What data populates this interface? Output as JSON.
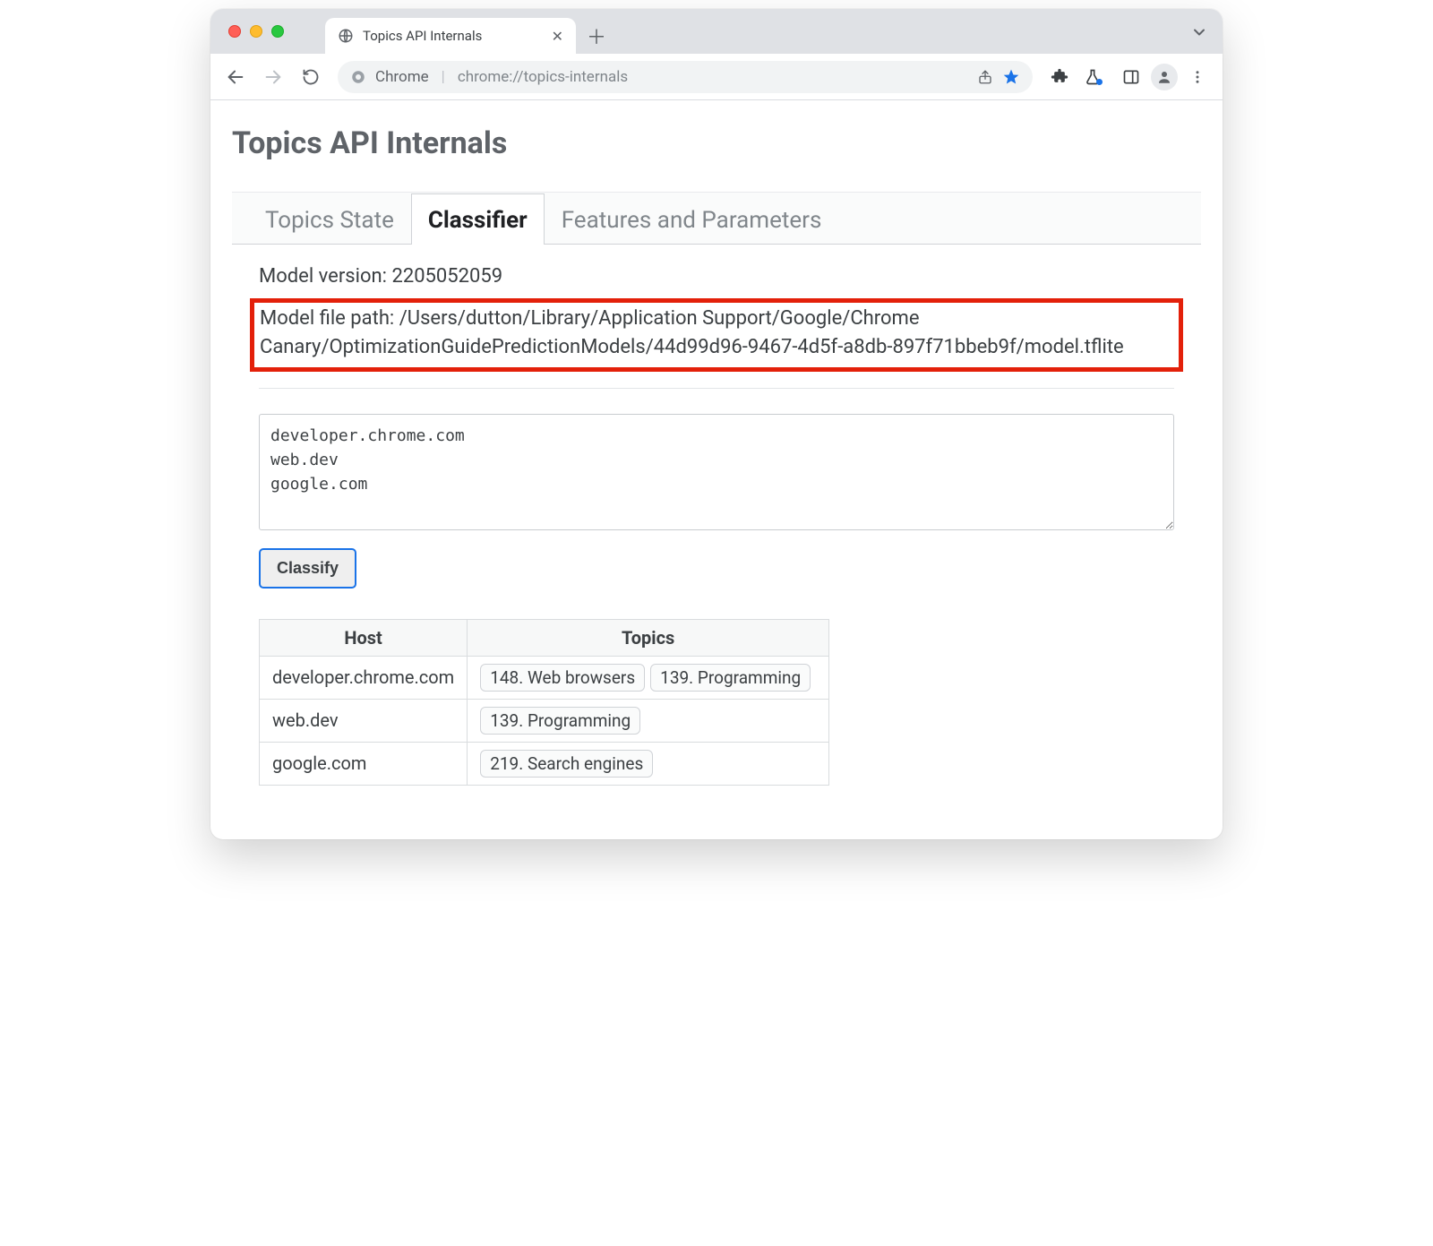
{
  "window": {
    "tab_title": "Topics API Internals",
    "tabs_overflow_tooltip": "Search tabs"
  },
  "toolbar": {
    "origin_label": "Chrome",
    "url": "chrome://topics-internals"
  },
  "page": {
    "title": "Topics API Internals",
    "tabs": [
      {
        "label": "Topics State",
        "active": false
      },
      {
        "label": "Classifier",
        "active": true
      },
      {
        "label": "Features and Parameters",
        "active": false
      }
    ],
    "model_version_label": "Model version:",
    "model_version": "2205052059",
    "model_path_label": "Model file path:",
    "model_path": "/Users/dutton/Library/Application Support/Google/Chrome Canary/OptimizationGuidePredictionModels/44d99d96-9467-4d5f-a8db-897f71bbeb9f/model.tflite",
    "hosts_input": "developer.chrome.com\nweb.dev\ngoogle.com",
    "classify_label": "Classify",
    "table": {
      "headers": [
        "Host",
        "Topics"
      ],
      "rows": [
        {
          "host": "developer.chrome.com",
          "topics": [
            "148. Web browsers",
            "139. Programming"
          ]
        },
        {
          "host": "web.dev",
          "topics": [
            "139. Programming"
          ]
        },
        {
          "host": "google.com",
          "topics": [
            "219. Search engines"
          ]
        }
      ]
    }
  }
}
